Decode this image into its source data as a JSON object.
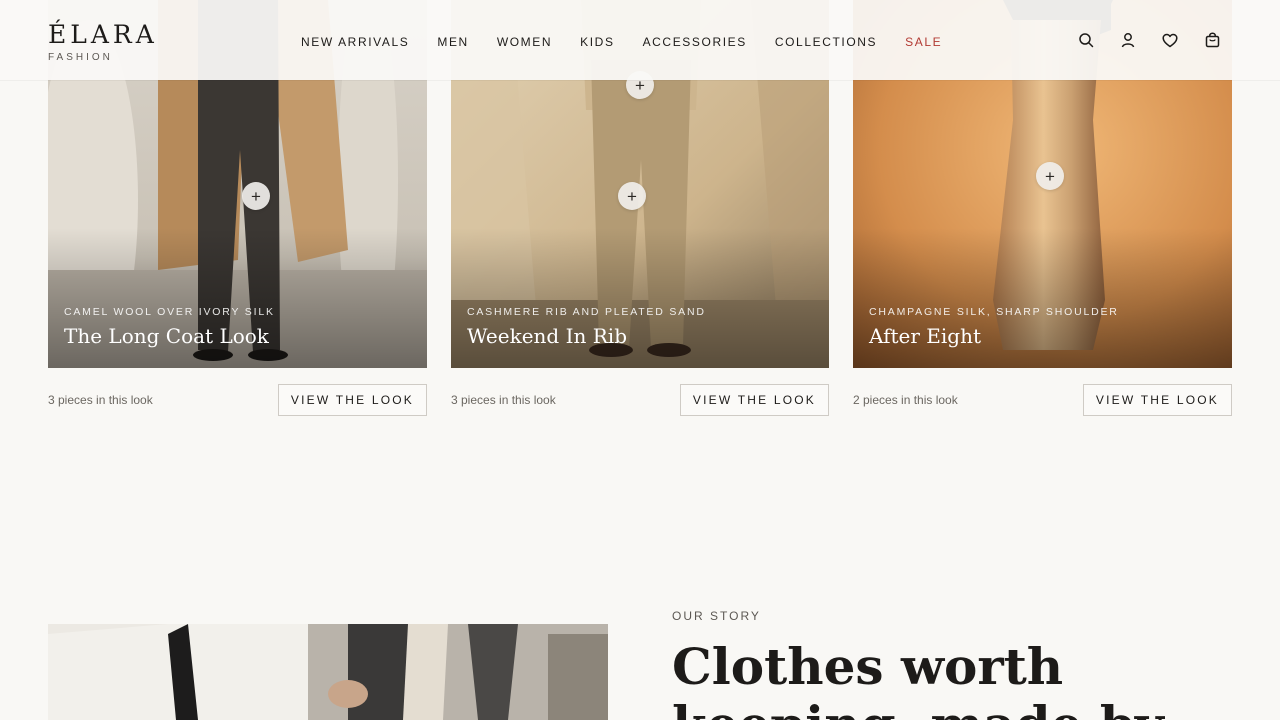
{
  "header": {
    "logo": "ÉLARA",
    "logo_sub": "FASHION",
    "nav": [
      "NEW ARRIVALS",
      "MEN",
      "WOMEN",
      "KIDS",
      "ACCESSORIES",
      "COLLECTIONS",
      "SALE"
    ],
    "sale_color": "#b23a33",
    "icons": [
      "search-icon",
      "account-icon",
      "heart-icon",
      "bag-icon"
    ]
  },
  "looks": [
    {
      "subtitle": "CAMEL WOOL OVER IVORY SILK",
      "title": "The Long Coat Look",
      "count": "3 pieces in this look",
      "button": "VIEW THE LOOK",
      "plus": "+"
    },
    {
      "subtitle": "CASHMERE RIB AND PLEATED SAND",
      "title": "Weekend In Rib",
      "count": "3 pieces in this look",
      "button": "VIEW THE LOOK",
      "plus": "+"
    },
    {
      "subtitle": "CHAMPAGNE SILK, SHARP SHOULDER",
      "title": "After Eight",
      "count": "2 pieces in this look",
      "button": "VIEW THE LOOK",
      "plus": "+"
    }
  ],
  "story": {
    "eyebrow": "OUR STORY",
    "title_line1": "Clothes worth",
    "title_line2": "keeping, made by"
  }
}
